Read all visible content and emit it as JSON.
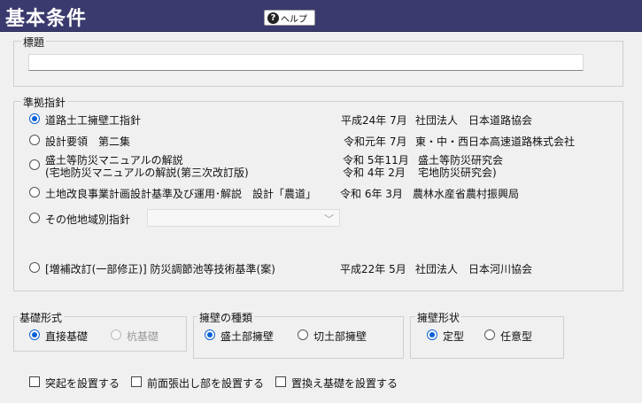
{
  "header": {
    "title": "基本条件",
    "help_label": "ヘルプ",
    "help_icon": "?"
  },
  "title_group": {
    "legend": "標題",
    "value": ""
  },
  "guideline_group": {
    "legend": "準拠指針",
    "options": [
      {
        "label": "道路土工擁壁工指針",
        "date": "平成24年 7月",
        "publisher": "社団法人　日本道路協会",
        "checked": true
      },
      {
        "label": "設計要領　第二集",
        "date": "令和元年 7月",
        "publisher": "東・中・西日本高速道路株式会社",
        "checked": false
      },
      {
        "label": "盛土等防災マニュアルの解説",
        "label2": "(宅地防災マニュアルの解説(第三次改訂版)",
        "date": "令和 5年11月",
        "publisher": "盛土等防災研究会",
        "date2": "令和 4年 2月",
        "publisher2": "宅地防災研究会)",
        "checked": false
      },
      {
        "label": "土地改良事業計画設計基準及び運用･解説　設計「農道」",
        "date": "令和 6年 3月",
        "publisher": "農林水産省農村振興局",
        "checked": false
      },
      {
        "label": "その他地域別指針",
        "checked": false
      },
      {
        "label": "[増補改訂(一部修正)] 防災調節池等技術基準(案)",
        "date": "平成22年 5月",
        "publisher": "社団法人　日本河川協会",
        "checked": false
      }
    ],
    "region_dropdown_value": ""
  },
  "foundation_group": {
    "legend": "基礎形式",
    "options": [
      {
        "label": "直接基礎",
        "checked": true
      },
      {
        "label": "杭基礎",
        "checked": false,
        "disabled": true
      }
    ]
  },
  "wall_type_group": {
    "legend": "擁壁の種類",
    "options": [
      {
        "label": "盛土部擁壁",
        "checked": true
      },
      {
        "label": "切土部擁壁",
        "checked": false
      }
    ]
  },
  "wall_shape_group": {
    "legend": "擁壁形状",
    "options": [
      {
        "label": "定型",
        "checked": true
      },
      {
        "label": "任意型",
        "checked": false
      }
    ]
  },
  "checkboxes": [
    {
      "label": "突起を設置する",
      "checked": false
    },
    {
      "label": "前面張出し部を設置する",
      "checked": false
    },
    {
      "label": "置換え基礎を設置する",
      "checked": false
    }
  ],
  "colors": {
    "titlebar": "#3a3a6e",
    "accent": "#0a5fd6"
  }
}
